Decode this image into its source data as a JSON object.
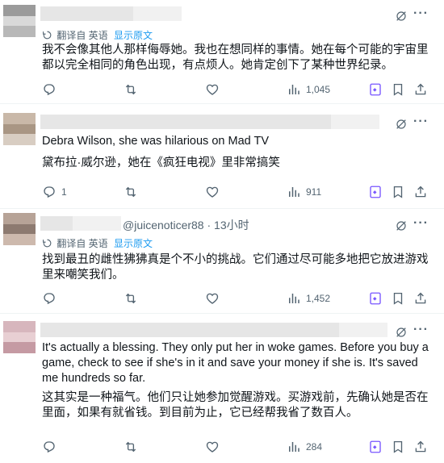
{
  "ui": {
    "colors": {
      "accent": "#1d9bf0",
      "muted": "#536471",
      "text": "#0f1419",
      "bookmark_accent": "#7856ff"
    },
    "icons": [
      "reply-icon",
      "retweet-icon",
      "like-icon",
      "views-icon",
      "grok-icon",
      "bookmark-icon",
      "share-icon",
      "more-icon",
      "translate-icon"
    ]
  },
  "replies": [
    {
      "translated_note": "翻译自 英语",
      "show_original": "显示原文",
      "text": "我不会像其他人那样侮辱她。我也在想同样的事情。她在每个可能的宇宙里都以完全相同的角色出现，有点烦人。她肯定创下了某种世界纪录。",
      "views": "1,045"
    },
    {
      "text": "Debra Wilson, she was hilarious on Mad TV",
      "translation": "黛布拉·威尔逊，她在《疯狂电视》里非常搞笑",
      "reply_count": "1",
      "views": "911"
    },
    {
      "handle_time": "@juicenoticer88 · 13小时",
      "translated_note": "翻译自 英语",
      "show_original": "显示原文",
      "text": "找到最丑的雌性狒狒真是个不小的挑战。它们通过尽可能多地把它放进游戏里来嘲笑我们。",
      "views": "1,452"
    },
    {
      "text": "It's actually a blessing. They only put her in woke games. Before you buy a game, check to see if she's in it and save your money if she is. It's saved me hundreds so far.",
      "translation": "这其实是一种福气。他们只让她参加觉醒游戏。买游戏前，先确认她是否在里面，如果有就省钱。到目前为止，它已经帮我省了数百人。",
      "views": "284"
    }
  ],
  "more_label": "···"
}
